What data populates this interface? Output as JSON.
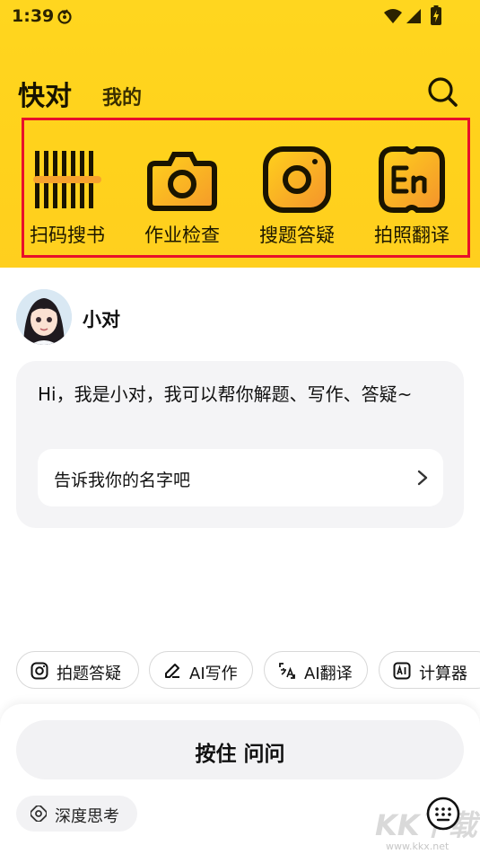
{
  "status_bar": {
    "time": "1:39"
  },
  "header": {
    "tab_active": "快对",
    "tab_other": "我的"
  },
  "tools": [
    {
      "label": "扫码搜书",
      "icon": "barcode-icon"
    },
    {
      "label": "作业检查",
      "icon": "camera-icon"
    },
    {
      "label": "搜题答疑",
      "icon": "lens-icon"
    },
    {
      "label": "拍照翻译",
      "icon": "translate-en-icon"
    }
  ],
  "assistant": {
    "name": "小对",
    "greeting": "Hi，我是小对，我可以帮你解题、写作、答疑~",
    "suggestion": "告诉我你的名字吧"
  },
  "quick_actions": [
    {
      "label": "拍题答疑",
      "icon": "camera-small-icon"
    },
    {
      "label": "AI写作",
      "icon": "pen-icon"
    },
    {
      "label": "AI翻译",
      "icon": "translate-icon"
    },
    {
      "label": "计算器",
      "icon": "ai-calculator-icon"
    }
  ],
  "bottom_bar": {
    "hold_to_ask": "按住 问问",
    "deep_think": "深度思考"
  },
  "watermark": {
    "text": "KK下载",
    "url": "www.kkx.net"
  },
  "colors": {
    "header_yellow": "#ffd61f",
    "highlight_red": "#e8102a",
    "icon_orange": "#f7a22d"
  }
}
